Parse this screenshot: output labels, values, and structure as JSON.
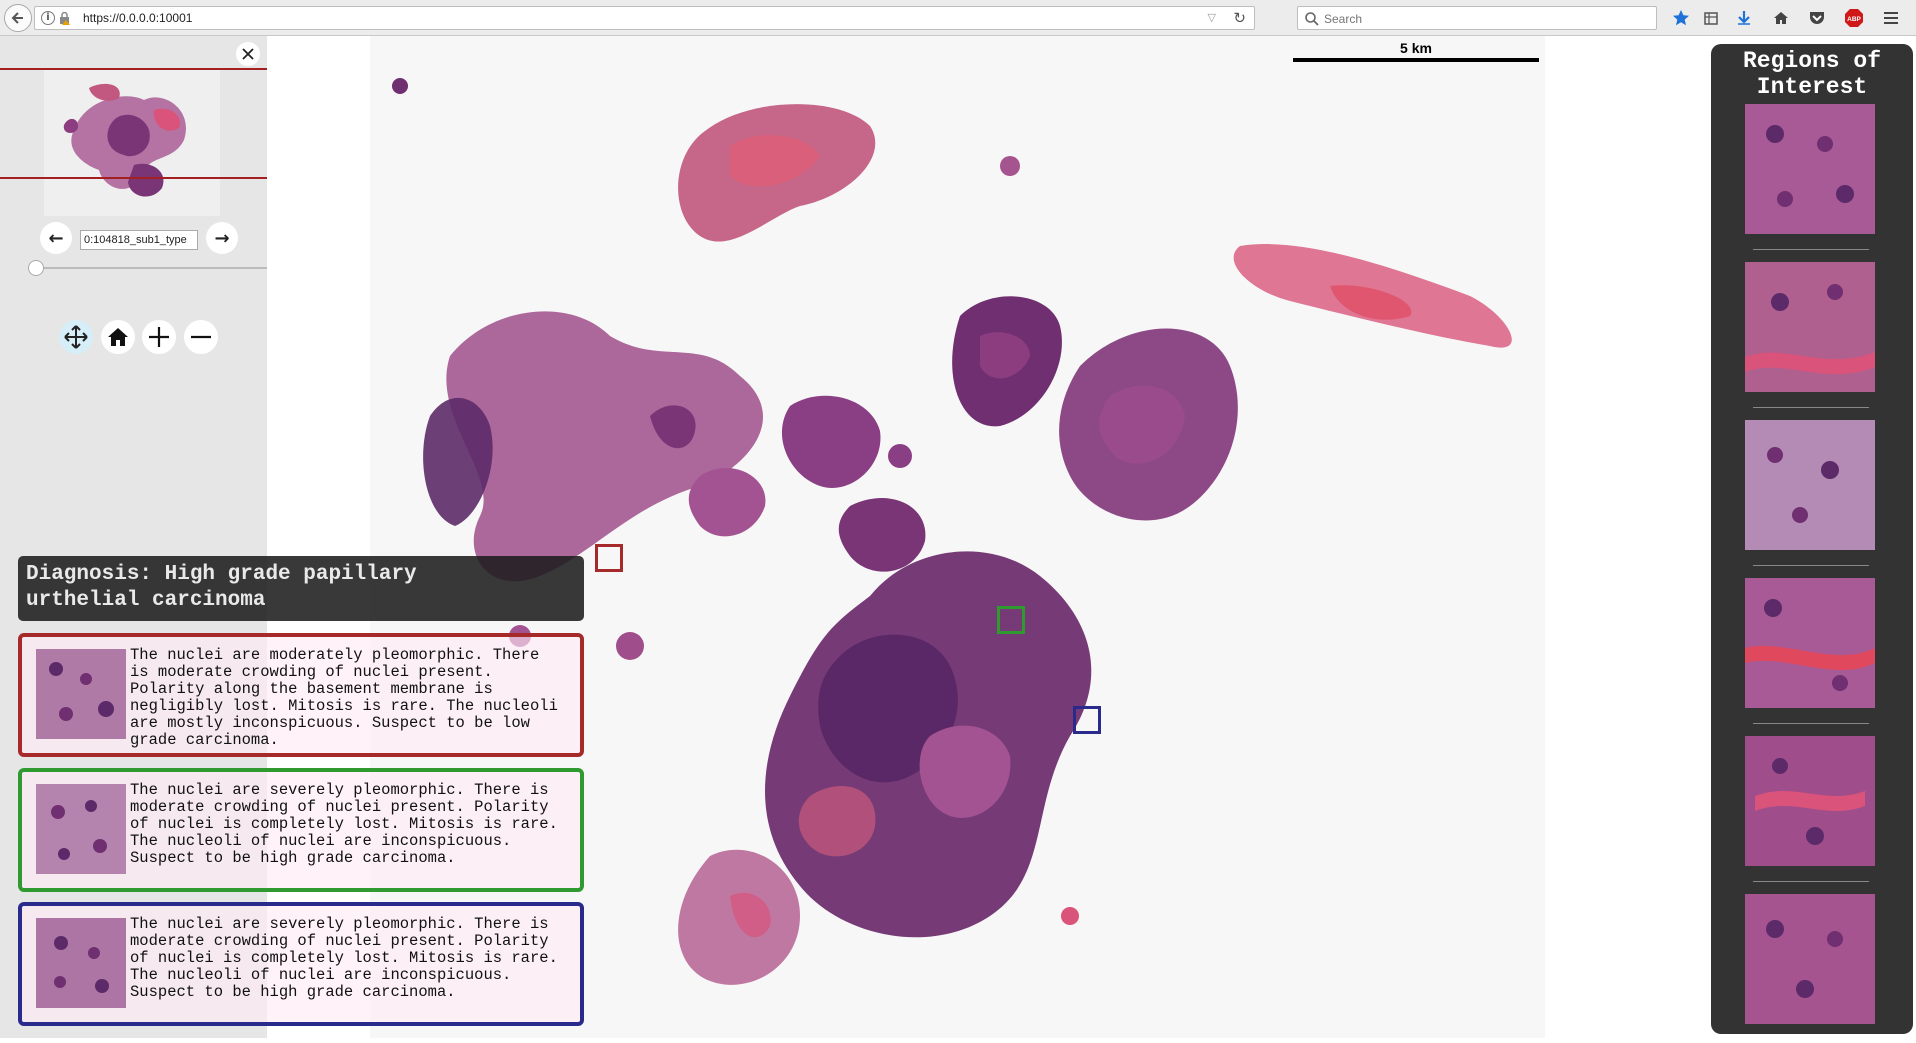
{
  "browser": {
    "url": "https://0.0.0.0:10001",
    "search_placeholder": "Search",
    "toolbar_icons": [
      "star-icon",
      "library-icon",
      "download-icon",
      "home-icon",
      "pocket-icon",
      "adblock-icon",
      "menu-icon"
    ],
    "adblock_label": "ABP"
  },
  "navigator": {
    "slide_id": "0:104818_sub1_type",
    "prev_label": "←",
    "next_label": "→",
    "tools": [
      "pan-icon",
      "home-icon",
      "zoom-in-icon",
      "zoom-out-icon"
    ]
  },
  "viewer": {
    "scale_label": "5 km"
  },
  "diagnosis": {
    "text": "Diagnosis: High grade papillary\nurthelial carcinoma"
  },
  "annotations": [
    {
      "color": "#a62a2a",
      "text": "The nuclei are moderately pleomorphic. There\nis moderate crowding of nuclei present.\nPolarity along the basement membrane is\nnegligibly lost. Mitosis is rare. The nucleoli\nare mostly inconspicuous. Suspect to be low\ngrade carcinoma."
    },
    {
      "color": "#2f9a2f",
      "text": "The nuclei are severely pleomorphic. There is\nmoderate crowding of nuclei present. Polarity\nof nuclei is completely lost. Mitosis is rare.\nThe nucleoli of nuclei are inconspicuous.\nSuspect to be high grade carcinoma."
    },
    {
      "color": "#2a2a8c",
      "text": "The nuclei are severely pleomorphic. There is\nmoderate crowding of nuclei present. Polarity\nof nuclei is completely lost. Mitosis is rare.\nThe nucleoli of nuclei are inconspicuous.\nSuspect to be high grade carcinoma."
    }
  ],
  "roi_panel": {
    "title": "Regions of\nInterest",
    "count": 6
  },
  "colors": {
    "tissue_dark": "#7a3577",
    "tissue_mid": "#a5548f",
    "tissue_pink": "#d9537a",
    "roi_red": "#a62a2a",
    "roi_green": "#2f9a2f",
    "roi_blue": "#2a2a8c"
  }
}
